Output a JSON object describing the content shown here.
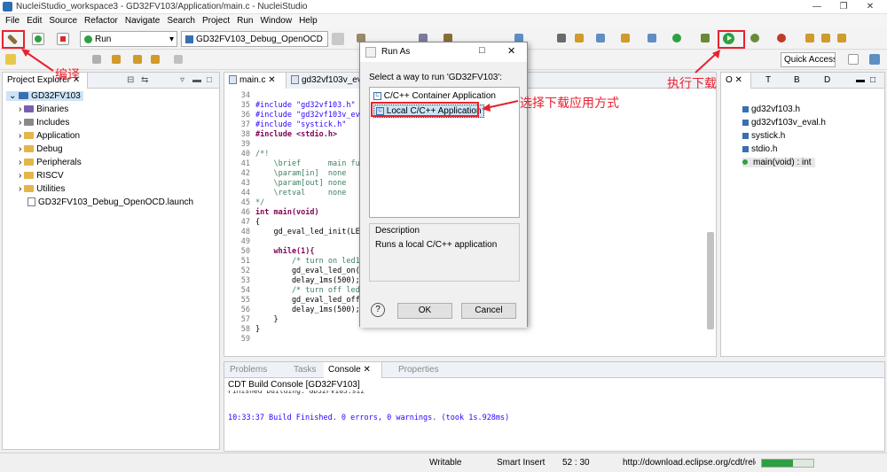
{
  "window": {
    "title": "NucleiStudio_workspace3 - GD32FV103/Application/main.c - NucleiStudio",
    "min": "—",
    "max": "❐",
    "close": "✕"
  },
  "menu": [
    "File",
    "Edit",
    "Source",
    "Refactor",
    "Navigate",
    "Search",
    "Project",
    "Run",
    "Window",
    "Help"
  ],
  "toolbar": {
    "run_mode": "Run",
    "launch_config": "GD32FV103_Debug_OpenOCD",
    "quick_access": "Quick Access"
  },
  "project_explorer": {
    "tab": "Project Explorer",
    "root": "GD32FV103",
    "items": [
      "Binaries",
      "Includes",
      "Application",
      "Debug",
      "Peripherals",
      "RISCV",
      "Utilities"
    ],
    "launch_file": "GD32FV103_Debug_OpenOCD.launch"
  },
  "editor": {
    "tabs": [
      "main.c",
      "gd32vf103v_eval.h"
    ],
    "lines": [
      {
        "n": "34",
        "t": ""
      },
      {
        "n": "35",
        "t": "#include \"gd32vf103.h\""
      },
      {
        "n": "36",
        "t": "#include \"gd32vf103v_eval"
      },
      {
        "n": "37",
        "t": "#include \"systick.h\""
      },
      {
        "n": "38",
        "t": "#include <stdio.h>"
      },
      {
        "n": "39",
        "t": ""
      },
      {
        "n": "40",
        "t": "/*!"
      },
      {
        "n": "41",
        "t": "    \\brief      main fun"
      },
      {
        "n": "42",
        "t": "    \\param[in]  none"
      },
      {
        "n": "43",
        "t": "    \\param[out] none"
      },
      {
        "n": "44",
        "t": "    \\retval     none"
      },
      {
        "n": "45",
        "t": "*/"
      },
      {
        "n": "46",
        "t": "int main(void)"
      },
      {
        "n": "47",
        "t": "{"
      },
      {
        "n": "48",
        "t": "    gd_eval_led_init(LED"
      },
      {
        "n": "49",
        "t": ""
      },
      {
        "n": "50",
        "t": "    while(1){"
      },
      {
        "n": "51",
        "t": "        /* turn on led1*"
      },
      {
        "n": "52",
        "t": "        gd_eval_led_on(L"
      },
      {
        "n": "53",
        "t": "        delay_1ms(500);"
      },
      {
        "n": "54",
        "t": "        /* turn off led1"
      },
      {
        "n": "55",
        "t": "        gd_eval_led_off("
      },
      {
        "n": "56",
        "t": "        delay_1ms(500);"
      },
      {
        "n": "57",
        "t": "    }"
      },
      {
        "n": "58",
        "t": "}"
      },
      {
        "n": "59",
        "t": ""
      }
    ]
  },
  "outline": {
    "tabs": [
      "O",
      "T",
      "B",
      "D"
    ],
    "items": [
      "gd32vf103.h",
      "gd32vf103v_eval.h",
      "systick.h",
      "stdio.h",
      "main(void) : int"
    ]
  },
  "console": {
    "tabs": [
      "Problems",
      "Tasks",
      "Console",
      "Properties"
    ],
    "header": "CDT Build Console [GD32FV103]",
    "cut_line": "Finished building: GD32FV103.siz",
    "message": "10:33:37 Build Finished. 0 errors, 0 warnings. (took 1s.928ms)"
  },
  "status": {
    "writable": "Writable",
    "insert": "Smart Insert",
    "position": "52 : 30",
    "url": "http://download.eclipse.org/cdt/releases/"
  },
  "dialog": {
    "title": "Run As",
    "prompt": "Select a way to run 'GD32FV103':",
    "options": [
      "C/C++ Container Application",
      "Local C/C++ Application"
    ],
    "description_label": "Description",
    "description": "Runs a local C/C++ application",
    "ok": "OK",
    "cancel": "Cancel",
    "help": "?"
  },
  "annotations": {
    "compile": "编译",
    "run_download": "执行下载",
    "choose": "选择下载应用方式"
  },
  "colors": {
    "annotation": "#e8212e",
    "run_green": "#2ea043",
    "folder": "#e3b54a"
  }
}
